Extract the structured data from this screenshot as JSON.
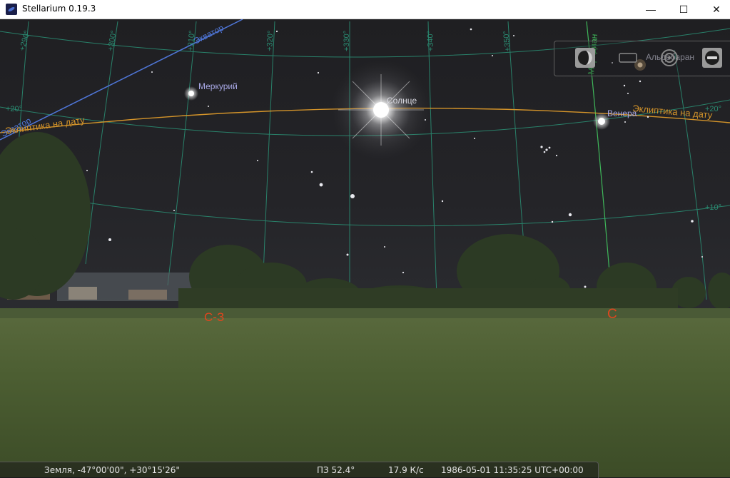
{
  "window": {
    "title": "Stellarium 0.19.3",
    "minimize": "—",
    "maximize": "☐",
    "close": "✕"
  },
  "sky": {
    "objects": {
      "sun": "Солнце",
      "mercury": "Меркурий",
      "venus": "Венера",
      "aldebaran": "Альдебаран"
    },
    "lines": {
      "ecliptic_left": "Эклиптика на дату",
      "ecliptic_right": "Эклиптика на дату",
      "equator": "Экватор",
      "equator_left": "Экватор",
      "meridian": "Меридиан"
    },
    "grid_labels": {
      "ra290": "+290°",
      "ra300": "+300°",
      "ra310": "+310°",
      "ra320": "+320°",
      "ra330": "+330°",
      "ra340": "+340°",
      "ra350": "+350°",
      "dec20_left": "+20°",
      "dec20_right": "+20°",
      "dec10": "+10°"
    },
    "cardinals": {
      "nw": "С-З",
      "n": "С"
    },
    "colors": {
      "ecliptic": "#d4942a",
      "equator": "#4f76d8",
      "grid": "#2a8c72",
      "meridian": "#3fb85a",
      "cardinal": "#e0461e"
    }
  },
  "panel": {
    "icons": [
      "stellarium-globe-icon",
      "window-frame-icon",
      "target-circle-icon",
      "quit-icon"
    ]
  },
  "status": {
    "location": "Земля, -47°00'00\", +30°15'26\"",
    "fov": "ПЗ 52.4°",
    "fps": "17.9 К/с",
    "datetime": "1986-05-01 11:35:25 UTC+00:00"
  }
}
